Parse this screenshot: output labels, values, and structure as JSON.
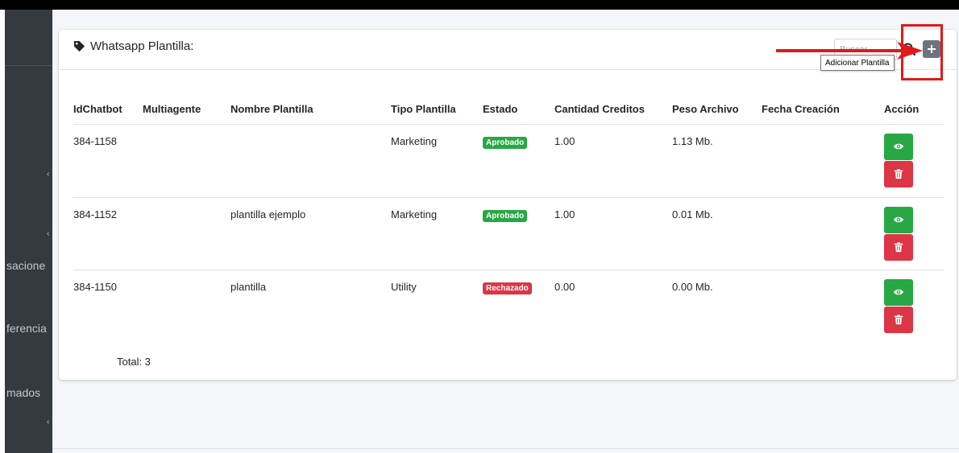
{
  "sidebar": {
    "items": [
      {
        "label": "sacione"
      },
      {
        "label": "ferencia"
      },
      {
        "label": "mados"
      }
    ]
  },
  "card": {
    "title": "Whatsapp Plantilla:",
    "search_placeholder": "Buscar",
    "add_button_tooltip": "Adicionar Plantilla"
  },
  "table": {
    "headers": [
      "IdChatbot",
      "Multiagente",
      "Nombre Plantilla",
      "Tipo Plantilla",
      "Estado",
      "Cantidad Creditos",
      "Peso Archivo",
      "Fecha Creación",
      "Acción"
    ],
    "rows": [
      {
        "id": "384-1158",
        "multiagente": "",
        "nombre": "",
        "tipo": "Marketing",
        "estado": "Aprobado",
        "creditos": "1.00",
        "peso": "1.13 Mb.",
        "fecha": ""
      },
      {
        "id": "384-1152",
        "multiagente": "",
        "nombre": "plantilla ejemplo",
        "tipo": "Marketing",
        "estado": "Aprobado",
        "creditos": "1.00",
        "peso": "0.01 Mb.",
        "fecha": ""
      },
      {
        "id": "384-1150",
        "multiagente": "",
        "nombre": "plantilla",
        "tipo": "Utility",
        "estado": "Rechazado",
        "creditos": "0.00",
        "peso": "0.00 Mb.",
        "fecha": ""
      }
    ],
    "total_label": "Total: 3"
  },
  "colors": {
    "sidebar_bg": "#343a40",
    "content_bg": "#f4f6f9",
    "success": "#28a745",
    "danger": "#dc3545",
    "secondary": "#6c757d",
    "annotation_red": "#e11919"
  },
  "icons": {
    "title": "tag-icon",
    "search": "search-icon",
    "add": "plus-icon",
    "view": "eye-icon",
    "delete": "trash-icon"
  }
}
